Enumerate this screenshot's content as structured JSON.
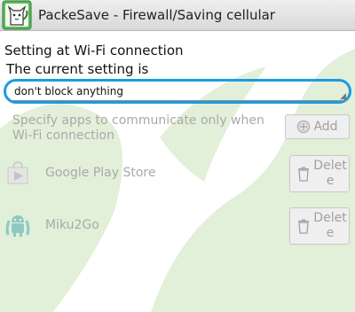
{
  "window": {
    "title": "PackeSave - Firewall/Saving cellular",
    "app_icon": "packesave-cat-icon"
  },
  "settings": {
    "section_title": "Setting at Wi-Fi connection",
    "current_label": "The current setting is",
    "select_value": "don't block anything",
    "specify_text": "Specify apps to communicate only when Wi-Fi connection",
    "add_label": "Add"
  },
  "apps": [
    {
      "name": "Google Play Store",
      "icon": "google-play-store-icon",
      "delete_label": "Delete"
    },
    {
      "name": "Miku2Go",
      "icon": "android-robot-icon",
      "delete_label": "Delete"
    }
  ],
  "colors": {
    "focus_ring": "#1d9be0",
    "watermark": "#dcebd2",
    "disabled_text": "#a9a9a9"
  }
}
